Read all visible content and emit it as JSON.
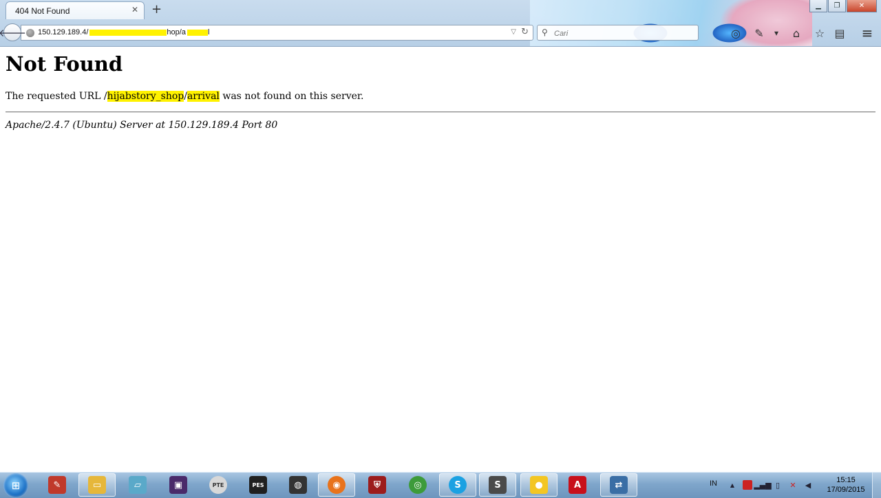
{
  "window": {
    "tab_title": "404 Not Found",
    "tab_close": "✕",
    "new_tab": "+",
    "minimize": "▁",
    "maximize": "❐",
    "close": "✕"
  },
  "navbar": {
    "back": "🡐",
    "url_prefix": "150.129.189.4/",
    "url_suffix": "hop/a",
    "url_tail": "l",
    "dropdown": "▽",
    "reload": "↻",
    "search_placeholder": "Cari",
    "search_icon": "⚲",
    "icons": {
      "chat": "◎",
      "extension": "✎",
      "more": "▾",
      "home": "⌂",
      "bookmark": "☆",
      "reader": "▤",
      "menu": "≡"
    }
  },
  "page": {
    "heading": "Not Found",
    "msg_before": "The requested URL /",
    "msg_redacted_1": "hijabstory_shop",
    "msg_slash": "/",
    "msg_redacted_2": "arrival",
    "msg_after": " was not found on this server.",
    "address": "Apache/2.4.7 (Ubuntu) Server at 150.129.189.4 Port 80"
  },
  "taskbar": {
    "start": "⊞",
    "apps": [
      {
        "name": "pen",
        "glyph": "✎",
        "color": "#c0392b"
      },
      {
        "name": "explorer",
        "glyph": "▭",
        "color": "#e6b73a"
      },
      {
        "name": "notes",
        "glyph": "▱",
        "color": "#5aa9c9"
      },
      {
        "name": "movie-maker",
        "glyph": "▣",
        "color": "#4a2a6a"
      },
      {
        "name": "pte-patch",
        "glyph": "PTE",
        "color": "#d8d8d8"
      },
      {
        "name": "pes",
        "glyph": "PES",
        "color": "#202020"
      },
      {
        "name": "game-app",
        "glyph": "◍",
        "color": "#333333"
      },
      {
        "name": "firefox",
        "glyph": "◉",
        "color": "#e8731c"
      },
      {
        "name": "shield-app",
        "glyph": "⛨",
        "color": "#9c1c1c"
      },
      {
        "name": "chrome",
        "glyph": "◎",
        "color": "#3d9b3a"
      },
      {
        "name": "skype",
        "glyph": "S",
        "color": "#1ba1e2"
      },
      {
        "name": "sublime",
        "glyph": "S",
        "color": "#4a4a4a"
      },
      {
        "name": "ball-app",
        "glyph": "●",
        "color": "#f3c623"
      },
      {
        "name": "acrobat",
        "glyph": "A",
        "color": "#c8101b"
      },
      {
        "name": "network-app",
        "glyph": "⇄",
        "color": "#3a6ea5"
      }
    ],
    "tray": {
      "language": "IN",
      "show_hidden": "▲",
      "time": "15:15",
      "date": "17/09/2015"
    }
  }
}
